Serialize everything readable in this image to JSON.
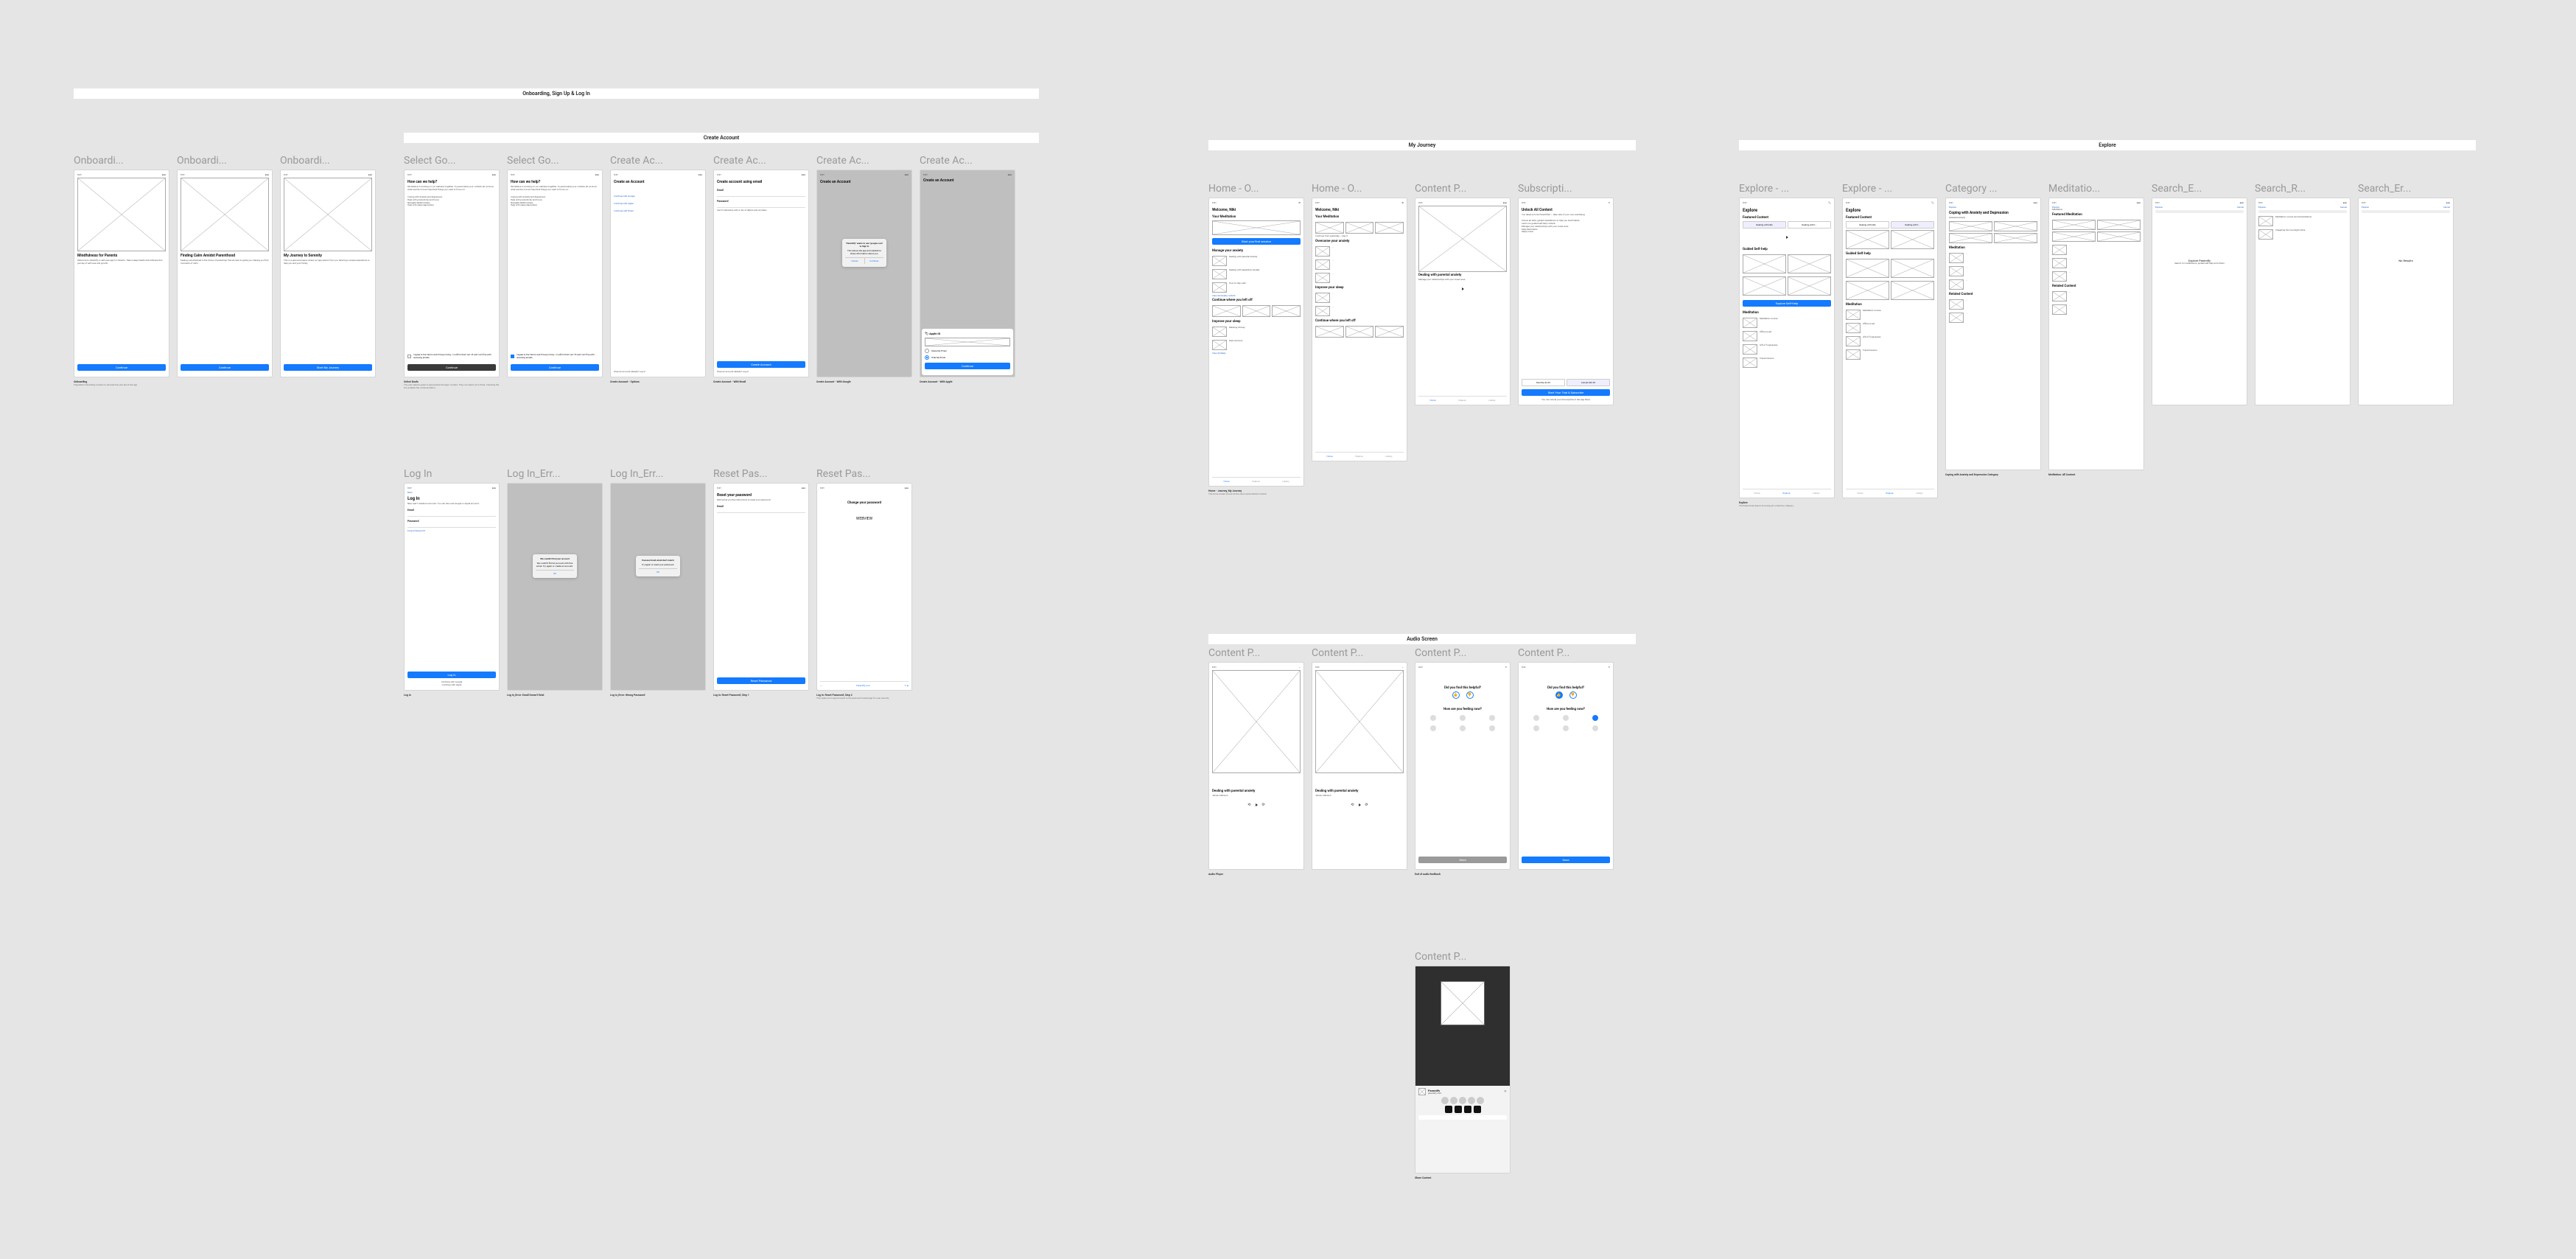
{
  "sections": {
    "onboarding": {
      "header": "Onboarding, Sign Up & Log In"
    },
    "create_account": {
      "header": "Create Account"
    },
    "my_journey": {
      "header": "My Journey"
    },
    "explore": {
      "header": "Explore"
    },
    "audio_screen": {
      "header": "Audio Screen"
    }
  },
  "common": {
    "status_time": "9:41",
    "status_icons": "●●●",
    "tab_home": "Home",
    "tab_explore": "Explore",
    "tab_library": "Library",
    "back": "Back"
  },
  "onboarding_screens": [
    {
      "title": "Onboardi...",
      "heading": "Mindfulness for Parents",
      "body": "Welcome to Parentify, a self-care app for Parents. Take a deep breath and embrace this journey of self-care and growth.",
      "cta": "Continue",
      "caption_title": "Onboarding",
      "caption_body": "Paginated onboarding screens to educate the user about the app."
    },
    {
      "title": "Onboardi...",
      "heading": "Finding Calm Amidst Parenthood",
      "body": "Feeling overwhelmed in the chaos of parenting? We are here to guide you, helping you find moments of calm.",
      "cta": "Continue",
      "caption_title": "",
      "caption_body": ""
    },
    {
      "title": "Onboardi...",
      "heading": "My Journey to Serenity",
      "body": "This is a personal space where our app learns from you, tailoring a unique experience to help you and your family.",
      "cta": "Start My Journey",
      "caption_title": "",
      "caption_body": ""
    }
  ],
  "select_goals": {
    "title": "Select Go...",
    "heading": "How can we help?",
    "body": "We believe in working on our wellness together. To personalize your content, let us know what are the 3 most important things you want to focus on.",
    "options": [
      "Coping with anxiety and depression",
      "Help with productivity and focus",
      "Navigate Relationships",
      "Help with sleep deprivation"
    ],
    "consent": "I agree to the Terms and Privacy Policy. I confirm that I am 18 and I am fine with receiving emails.",
    "cta": "Continue",
    "caption_title": "Select Goals",
    "caption_body": "The user selects goals to personalize the app's content. They can select up to three. Checking the box enables the continue button."
  },
  "create_account": {
    "title": "Create Ac...",
    "heading": "Create an Account",
    "link_google": "Continue with Google",
    "link_apple": "Continue with Apple",
    "link_email": "Continue with Email",
    "footer": "Have an account already? Log in",
    "caption_title": "Create Account - Options",
    "caption_body": "Choose account creation method."
  },
  "create_email": {
    "title": "Create Ac...",
    "heading": "Create account using email",
    "fields": [
      "Email",
      "Password"
    ],
    "hint": "Use 8 characters with a mix of letters and numbers",
    "cta": "Create Account",
    "footer": "Have an account already? Log in",
    "caption_title": "Create Account - With Email",
    "caption_body": ""
  },
  "create_google": {
    "title": "Create Ac...",
    "heading": "Create an Account",
    "modal": "\"Parentify\" wants to use \"google.com\" to Sign In",
    "modal_sub": "This allows the app and website to share information about you.",
    "modal_btns": [
      "Cancel",
      "Continue"
    ],
    "caption_title": "Create Account - With Google",
    "caption_body": ""
  },
  "create_apple": {
    "title": "Create Ac...",
    "heading": "Create an Account",
    "apple_id": "Apple ID",
    "email_share": "Share My Email",
    "email_hide": "Hide My Email",
    "cta": "Continue",
    "caption_title": "Create Account - With Apple",
    "caption_body": ""
  },
  "login": {
    "title": "Log In",
    "heading": "Log In",
    "sub": "New user? Create an account. You can also use Google or Apple account.",
    "fields": [
      "Email",
      "Password"
    ],
    "forgot": "Forgot Password?",
    "cta": "Log In",
    "alt": "Continue with Google",
    "alt2": "Continue with Apple",
    "caption_title": "Log In",
    "caption_body": ""
  },
  "login_err1": {
    "title": "Log In_Err...",
    "modal": "We couldn't find your account",
    "modal_sub": "We couldn't find an account with this email. Try again or create an account.",
    "ok": "OK",
    "caption_title": "Log In_Error: Email Doesn't Exist",
    "caption_body": ""
  },
  "login_err2": {
    "title": "Log In_Err...",
    "modal": "Password and email don't match",
    "modal_sub": "Try again or reset your password.",
    "ok": "OK",
    "caption_title": "Log In_Error: Wrong Password",
    "caption_body": ""
  },
  "reset_pw": {
    "title": "Reset Pas...",
    "heading": "Reset your password",
    "sub": "We'll email you the instructions to reset your password.",
    "field": "Email",
    "cta": "Reset Password",
    "caption_title": "Log In: Reset Password, Step 1",
    "caption_body": ""
  },
  "reset_pw2": {
    "title": "Reset Pas...",
    "heading": "Change your password",
    "webview": "WEBVIEW",
    "toolbar": "Parentify.com",
    "caption_title": "Log In: Reset Password, Step 2",
    "caption_body": "This opens an in-app browser to the password reset page for user security."
  },
  "journey": {
    "home1": {
      "title": "Home - O...",
      "welcome": "Welcome, Niki",
      "sub1": "Your Meditation",
      "cta1": "Start your first session",
      "sub2": "Manage your anxiety",
      "list": [
        "Dealing with parental anxiety",
        "Dealing with separation anxiety",
        "How to stay calm"
      ],
      "more": "View all anxiety content",
      "sub3": "Continue where you left off",
      "sec4": "Improve your sleep",
      "list2": [
        "Relaxing drowsy",
        "Dark horizons"
      ],
      "more2": "View all Sleep",
      "caption_title": "Home - Journey, My Journey",
      "caption_body": "The home screen shows all the user's personalized content."
    },
    "home2": {
      "title": "Home - O...",
      "welcome": "Welcome, Niki",
      "sec1": "Your Meditation",
      "sub1": "Continue from yesterday — Day 6",
      "sec2": "Overcome your anxiety",
      "sec3": "Improve your sleep",
      "sec4": "Continue where you left off",
      "caption_title": "",
      "caption_body": ""
    },
    "content": {
      "title": "Content P...",
      "sec1": "Dealing with parental anxiety",
      "sub1": "Manage your relationships with your loved ones.",
      "caption_title": "",
      "caption_body": ""
    },
    "subs": {
      "title": "Subscripti...",
      "heading": "Unlock All Content",
      "body": "You deserve to be Parentified — take care of your own well-being.",
      "bullets": [
        "Unlock all 200+ guided meditations to help you build habits.",
        "Learn our guided self-help content.",
        "Manage your relationships with your loved ones.",
        "Daily Reminders",
        "Sleep music"
      ],
      "tiers": [
        "Monthly $4.99",
        "Annual $49.99"
      ],
      "cta": "Start Your Trial & Subscribe",
      "note": "You can cancel your trial anytime in the App Store"
    }
  },
  "explore": {
    "e1": {
      "title": "Explore - ...",
      "heading": "Explore",
      "sec1": "Featured Content",
      "pill1": "Dealing with kids",
      "pill2": "Dealing with t...",
      "sec2": "Guided Self-help",
      "btn1": "Explore Self-Help",
      "sec3": "Meditation",
      "list": [
        "Meditation Course",
        "Office re-set",
        "Gift of forgiveness",
        "Transmissions"
      ],
      "caption_title": "Explore",
      "caption_body": "The Explore tab allows browsing all content by category."
    },
    "e2": {
      "title": "Explore - ...",
      "heading": "Explore",
      "sec1": "Featured Content",
      "sec2": "Guided Self-help",
      "sec3": "Meditation",
      "list": [
        "Meditation Course",
        "Office re-set",
        "Gift of forgiveness",
        "Transmissions"
      ]
    },
    "cat": {
      "title": "Category ...",
      "back": "Explore",
      "heading": "Coping with Anxiety and Depression",
      "crumb": "Featured anxiety",
      "sec2": "Meditation",
      "sec3": "Related Content",
      "caption_title": "Coping with Anxiety and Depression Category",
      "caption_body": ""
    },
    "med": {
      "title": "Meditatio...",
      "back": "Explore",
      "crumb": "Meditation",
      "sec1": "Featured Meditation",
      "sec2": "Related Content",
      "caption_title": "Meditation: All Content",
      "caption_body": ""
    },
    "search_e": {
      "title": "Search_E...",
      "back": "Cancel",
      "crumb": "Explore",
      "body": "Explore Parentify",
      "sub": "Search for meditations, guided self-help and others"
    },
    "search_r": {
      "title": "Search_R...",
      "back": "Cancel",
      "crumb": "Explore",
      "list": [
        "Meditation course recommendations",
        "Imagining the moonlight shine"
      ]
    },
    "search_err": {
      "title": "Search_Er...",
      "back": "Cancel",
      "crumb": "Explore",
      "body": "No Results"
    }
  },
  "audio": {
    "p1": {
      "title": "Content P...",
      "heading": "Dealing with parental anxiety",
      "sub": "James Atkinson",
      "caption_title": "Audio Player",
      "caption_body": ""
    },
    "p2": {
      "title": "Content P...",
      "heading": "Dealing with parental anxiety",
      "sub": "James Atkinson"
    },
    "p3": {
      "title": "Content P...",
      "heading": "Did you find this helpful?",
      "sub": "How are you feeling now?",
      "labels": [
        "Calm",
        "Bad",
        "Anxious",
        "Happy",
        "Sad",
        "Good"
      ],
      "cta": "Send",
      "caption_title": "End of audio feedback",
      "caption_body": ""
    },
    "p4": {
      "title": "Content P...",
      "heading": "Did you find this helpful?",
      "sub": "How are you feeling now?",
      "cta": "Send"
    },
    "p5": {
      "title": "Content P...",
      "heading": "Parentify",
      "caption_title": "Share Content",
      "caption_body": ""
    }
  }
}
